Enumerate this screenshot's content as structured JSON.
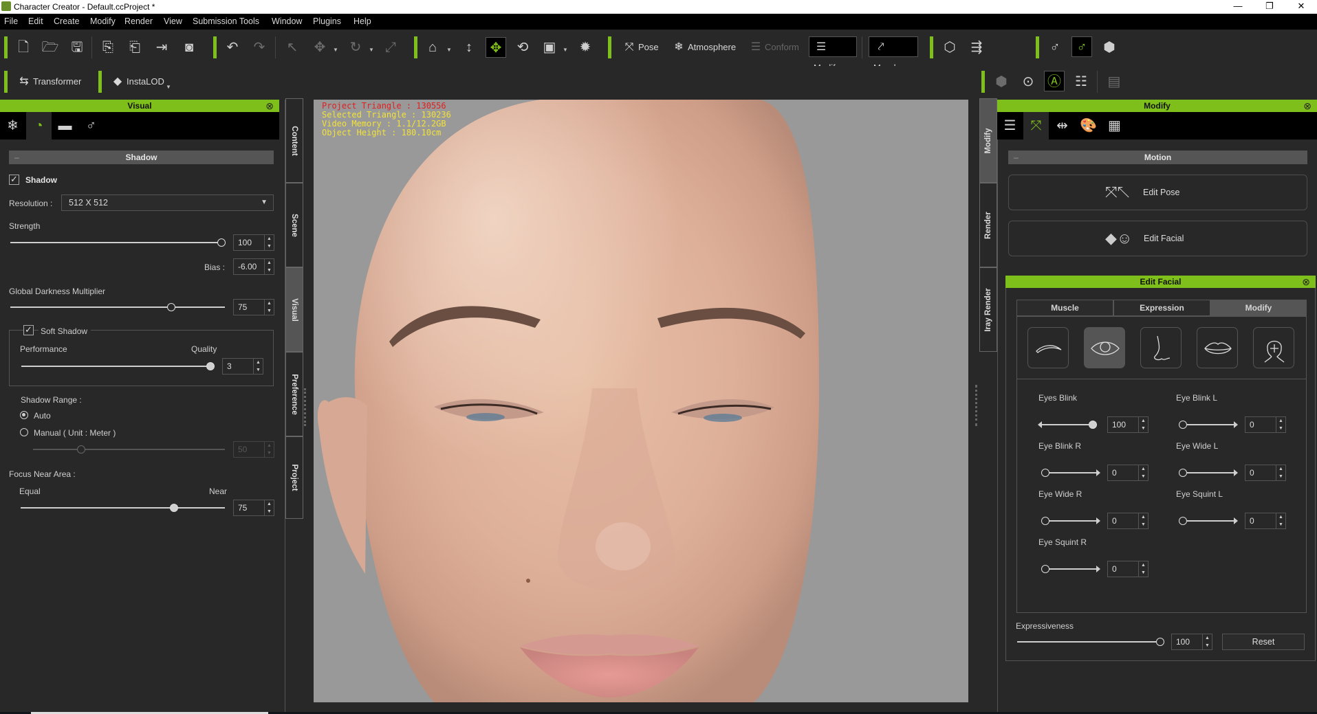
{
  "window": {
    "title": "Character Creator - Default.ccProject *",
    "minimize_label": "—",
    "maximize_label": "❐",
    "close_label": "✕"
  },
  "menu": [
    "File",
    "Edit",
    "Create",
    "Modify",
    "Render",
    "View",
    "Submission Tools",
    "Window",
    "Plugins",
    "Help"
  ],
  "toolbar": {
    "pose_label": "Pose",
    "atmosphere_label": "Atmosphere",
    "conform_label": "Conform",
    "modify_label": "Modify",
    "morph_label": "Morph",
    "transformer_label": "Transformer",
    "instalod_label": "InstaLOD"
  },
  "accent_color": "#7fbf1b",
  "left_panel": {
    "title": "Visual",
    "section_title": "Shadow",
    "shadow_checkbox_label": "Shadow",
    "shadow_checked": true,
    "resolution_label": "Resolution :",
    "resolution_value": "512  X  512",
    "strength_label": "Strength",
    "strength_value": "100",
    "strength_fraction": 1.0,
    "bias_label": "Bias :",
    "bias_value": "-6.00",
    "darkness_label": "Global Darkness Multiplier",
    "darkness_value": "75",
    "darkness_fraction": 0.75,
    "soft_shadow_label": "Soft Shadow",
    "soft_shadow_checked": true,
    "performance_label": "Performance",
    "quality_label": "Quality",
    "soft_quality_value": "3",
    "soft_quality_fraction": 1.0,
    "shadow_range_label": "Shadow Range :",
    "range_auto_label": "Auto",
    "range_manual_label": "Manual ( Unit : Meter )",
    "range_selected": "Auto",
    "manual_value": "50",
    "manual_fraction": 0.25,
    "focus_label": "Focus Near Area :",
    "equal_label": "Equal",
    "near_label": "Near",
    "focus_value": "75",
    "focus_fraction": 0.75
  },
  "left_vtabs": [
    "Content",
    "Scene",
    "Visual",
    "Preference",
    "Project"
  ],
  "left_vtab_active": "Visual",
  "viewport": {
    "project_triangle": "Project Triangle : 130556",
    "selected_triangle": "Selected Triangle : 130236",
    "video_memory": "Video Memory : 1.1/12.2GB",
    "object_height": "Object Height : 180.10cm"
  },
  "right_vtabs": [
    "Modify",
    "Render",
    "Iray Render"
  ],
  "right_vtab_active": "Modify",
  "right_panel": {
    "title": "Modify",
    "section_title": "Motion",
    "edit_pose_label": "Edit Pose",
    "edit_facial_label": "Edit Facial",
    "facial": {
      "title": "Edit Facial",
      "tabs": [
        "Muscle",
        "Expression",
        "Modify"
      ],
      "active_tab": "Modify",
      "features": [
        "eyebrow",
        "eye",
        "nose",
        "lips",
        "head"
      ],
      "active_feature": "eye",
      "sliders": [
        {
          "label": "Eyes Blink",
          "value": "100",
          "fraction": 1.0
        },
        {
          "label": "Eye Blink L",
          "value": "0",
          "fraction": 0.0
        },
        {
          "label": "Eye Blink R",
          "value": "0",
          "fraction": 0.0
        },
        {
          "label": "Eye Wide L",
          "value": "0",
          "fraction": 0.0
        },
        {
          "label": "Eye Wide R",
          "value": "0",
          "fraction": 0.0
        },
        {
          "label": "Eye Squint L",
          "value": "0",
          "fraction": 0.0
        },
        {
          "label": "Eye Squint R",
          "value": "0",
          "fraction": 0.0
        }
      ],
      "expressiveness_label": "Expressiveness",
      "expressiveness_value": "100",
      "expressiveness_fraction": 1.0,
      "reset_label": "Reset"
    }
  }
}
